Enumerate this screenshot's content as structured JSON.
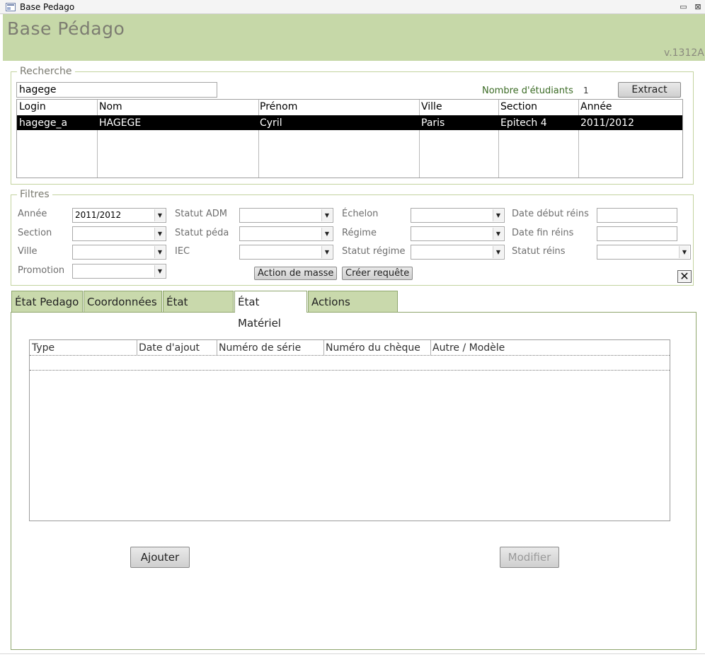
{
  "window": {
    "title": "Base Pedago",
    "minimize_glyph": "▭",
    "close_glyph": "⊠"
  },
  "header": {
    "title": "Base Pédago",
    "version": "v.1312A"
  },
  "search": {
    "legend": "Recherche",
    "query": "hagege",
    "count_label": "Nombre d'étudiants",
    "count_value": "1",
    "extract_label": "Extract",
    "columns": [
      "Login",
      "Nom",
      "Prénom",
      "Ville",
      "Section",
      "Année"
    ],
    "rows": [
      [
        "hagege_a",
        "HAGEGE",
        "Cyril",
        "Paris",
        "Epitech 4",
        "2011/2012"
      ]
    ]
  },
  "filters": {
    "legend": "Filtres",
    "annee": {
      "label": "Année",
      "value": "2011/2012"
    },
    "section": {
      "label": "Section",
      "value": ""
    },
    "ville": {
      "label": "Ville",
      "value": ""
    },
    "promotion": {
      "label": "Promotion",
      "value": ""
    },
    "statut_adm": {
      "label": "Statut ADM",
      "value": ""
    },
    "statut_peda": {
      "label": "Statut péda",
      "value": ""
    },
    "iec": {
      "label": "IEC",
      "value": ""
    },
    "echelon": {
      "label": "Échelon",
      "value": ""
    },
    "regime": {
      "label": "Régime",
      "value": ""
    },
    "statut_regime": {
      "label": "Statut régime",
      "value": ""
    },
    "date_debut": {
      "label": "Date début réins",
      "value": ""
    },
    "date_fin": {
      "label": "Date fin réins",
      "value": ""
    },
    "statut_reins": {
      "label": "Statut réins",
      "value": ""
    },
    "mass_action_label": "Action de masse",
    "create_query_label": "Créer requête",
    "clear_glyph": "✕"
  },
  "tabs": [
    {
      "label": "État Pedago",
      "active": false
    },
    {
      "label": "Coordonnées",
      "active": false
    },
    {
      "label": "État Finance",
      "active": false
    },
    {
      "label": "État Matériel",
      "active": true
    },
    {
      "label": "Actions Étudiant",
      "active": false
    }
  ],
  "material": {
    "columns": [
      "Type",
      "Date d'ajout",
      "Numéro de série",
      "Numéro du chèque",
      "Autre / Modèle"
    ],
    "add_label": "Ajouter",
    "edit_label": "Modifier"
  },
  "colors": {
    "header_bg": "#c6d8a8",
    "selected_row": "#000000",
    "tab_bg": "#c9d9ac"
  }
}
